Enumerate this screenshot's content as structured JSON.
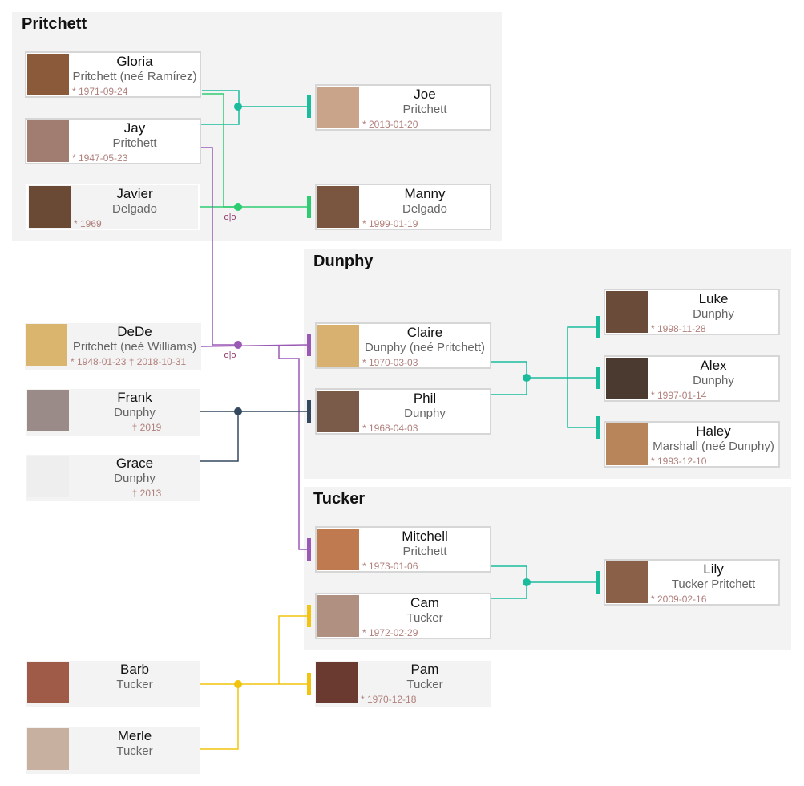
{
  "groups": [
    {
      "id": "pritchett",
      "title": "Pritchett"
    },
    {
      "id": "dunphy",
      "title": "Dunphy"
    },
    {
      "id": "tucker",
      "title": "Tucker"
    }
  ],
  "people": [
    {
      "id": "gloria",
      "name": "Gloria",
      "surname": "Pritchett (neé Ramírez)",
      "dates": "* 1971-09-24",
      "photo": "#8a5a3a"
    },
    {
      "id": "jay",
      "name": "Jay",
      "surname": "Pritchett",
      "dates": "* 1947-05-23",
      "photo": "#a07d70"
    },
    {
      "id": "javier",
      "name": "Javier",
      "surname": "Delgado",
      "dates": "* 1969",
      "photo": "#6b4a35"
    },
    {
      "id": "joe",
      "name": "Joe",
      "surname": "Pritchett",
      "dates": "* 2013-01-20",
      "photo": "#c9a48a"
    },
    {
      "id": "manny",
      "name": "Manny",
      "surname": "Delgado",
      "dates": "* 1999-01-19",
      "photo": "#7a5540"
    },
    {
      "id": "dede",
      "name": "DeDe",
      "surname": "Pritchett (neé Williams)",
      "dates": "* 1948-01-23  † 2018-10-31",
      "photo": "#d9b56e"
    },
    {
      "id": "frank",
      "name": "Frank",
      "surname": "Dunphy",
      "dates": "† 2019",
      "photo": "#9a8a88"
    },
    {
      "id": "grace",
      "name": "Grace",
      "surname": "Dunphy",
      "dates": "† 2013",
      "photo": "#eeeeee"
    },
    {
      "id": "claire",
      "name": "Claire",
      "surname": "Dunphy (neé Pritchett)",
      "dates": "* 1970-03-03",
      "photo": "#d8b070"
    },
    {
      "id": "phil",
      "name": "Phil",
      "surname": "Dunphy",
      "dates": "* 1968-04-03",
      "photo": "#7a5a48"
    },
    {
      "id": "luke",
      "name": "Luke",
      "surname": "Dunphy",
      "dates": "* 1998-11-28",
      "photo": "#6a4a38"
    },
    {
      "id": "alex",
      "name": "Alex",
      "surname": "Dunphy",
      "dates": "* 1997-01-14",
      "photo": "#4a3a30"
    },
    {
      "id": "haley",
      "name": "Haley",
      "surname": "Marshall (neé Dunphy)",
      "dates": "* 1993-12-10",
      "photo": "#b8845a"
    },
    {
      "id": "mitchell",
      "name": "Mitchell",
      "surname": "Pritchett",
      "dates": "* 1973-01-06",
      "photo": "#c07a50"
    },
    {
      "id": "cam",
      "name": "Cam",
      "surname": "Tucker",
      "dates": "* 1972-02-29",
      "photo": "#b09080"
    },
    {
      "id": "lily",
      "name": "Lily",
      "surname": "Tucker Pritchett",
      "dates": "* 2009-02-16",
      "photo": "#8a6048"
    },
    {
      "id": "pam",
      "name": "Pam",
      "surname": "Tucker",
      "dates": "* 1970-12-18",
      "photo": "#6a3a30"
    },
    {
      "id": "barb",
      "name": "Barb",
      "surname": "Tucker",
      "dates": "",
      "photo": "#a05a48"
    },
    {
      "id": "merle",
      "name": "Merle",
      "surname": "Tucker",
      "dates": "",
      "photo": "#c8b0a0"
    }
  ],
  "colors": {
    "teal": "#1abc9c",
    "green": "#2ecc71",
    "purple": "#9b59b6",
    "slate": "#34495e",
    "yellow": "#f1c40f"
  },
  "divorce_marker": "o|o"
}
